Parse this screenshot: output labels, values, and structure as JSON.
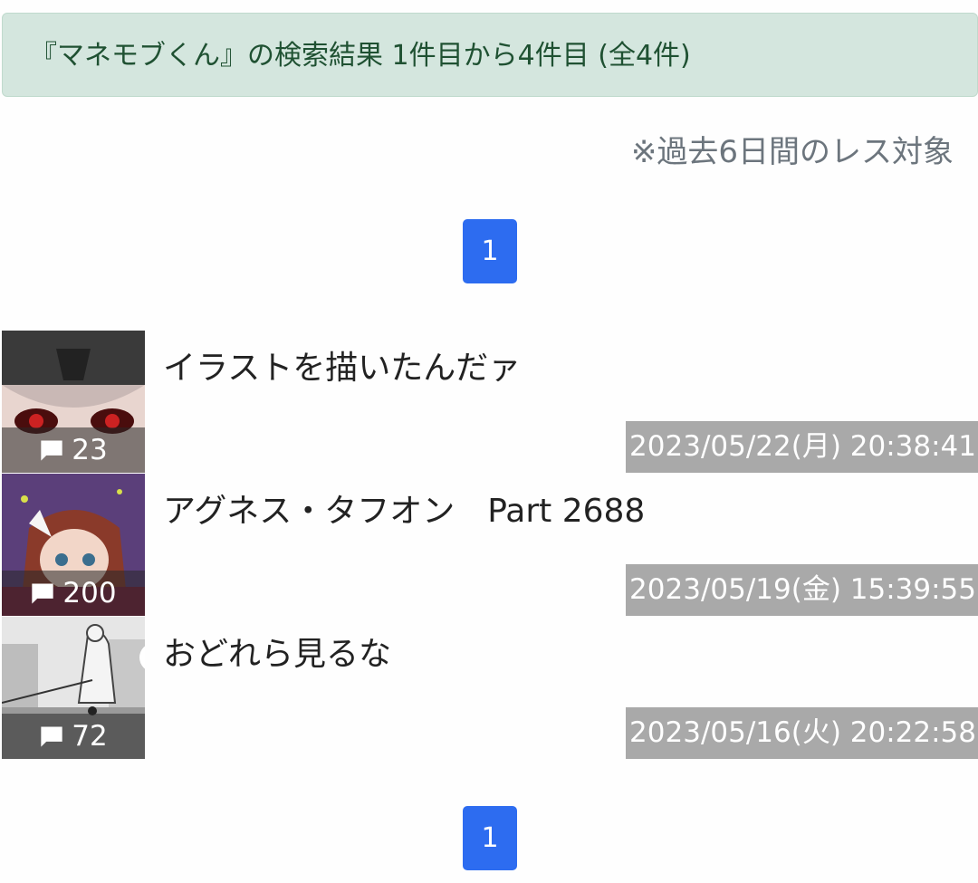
{
  "search_result": {
    "summary": "『マネモブくん』の検索結果 1件目から4件目 (全4件)"
  },
  "note": "※過去6日間のレス対象",
  "pagination": {
    "top_page": "1",
    "bottom_page": "1"
  },
  "threads": [
    {
      "title": "イラストを描いたんだァ",
      "res_count": "23",
      "date": "2023/05/22(月) 20:38:41"
    },
    {
      "title": "アグネス・タフオン　Part 2688",
      "res_count": "200",
      "date": "2023/05/19(金) 15:39:55"
    },
    {
      "title": "おどれら見るな",
      "res_count": "72",
      "date": "2023/05/16(火) 20:22:58"
    }
  ],
  "icons": {
    "comment": "comment-icon"
  },
  "colors": {
    "alert_bg": "#d4e6de",
    "alert_text": "#1f5132",
    "pager_bg": "#2d6cf0",
    "date_bg": "#a9a9a9"
  }
}
